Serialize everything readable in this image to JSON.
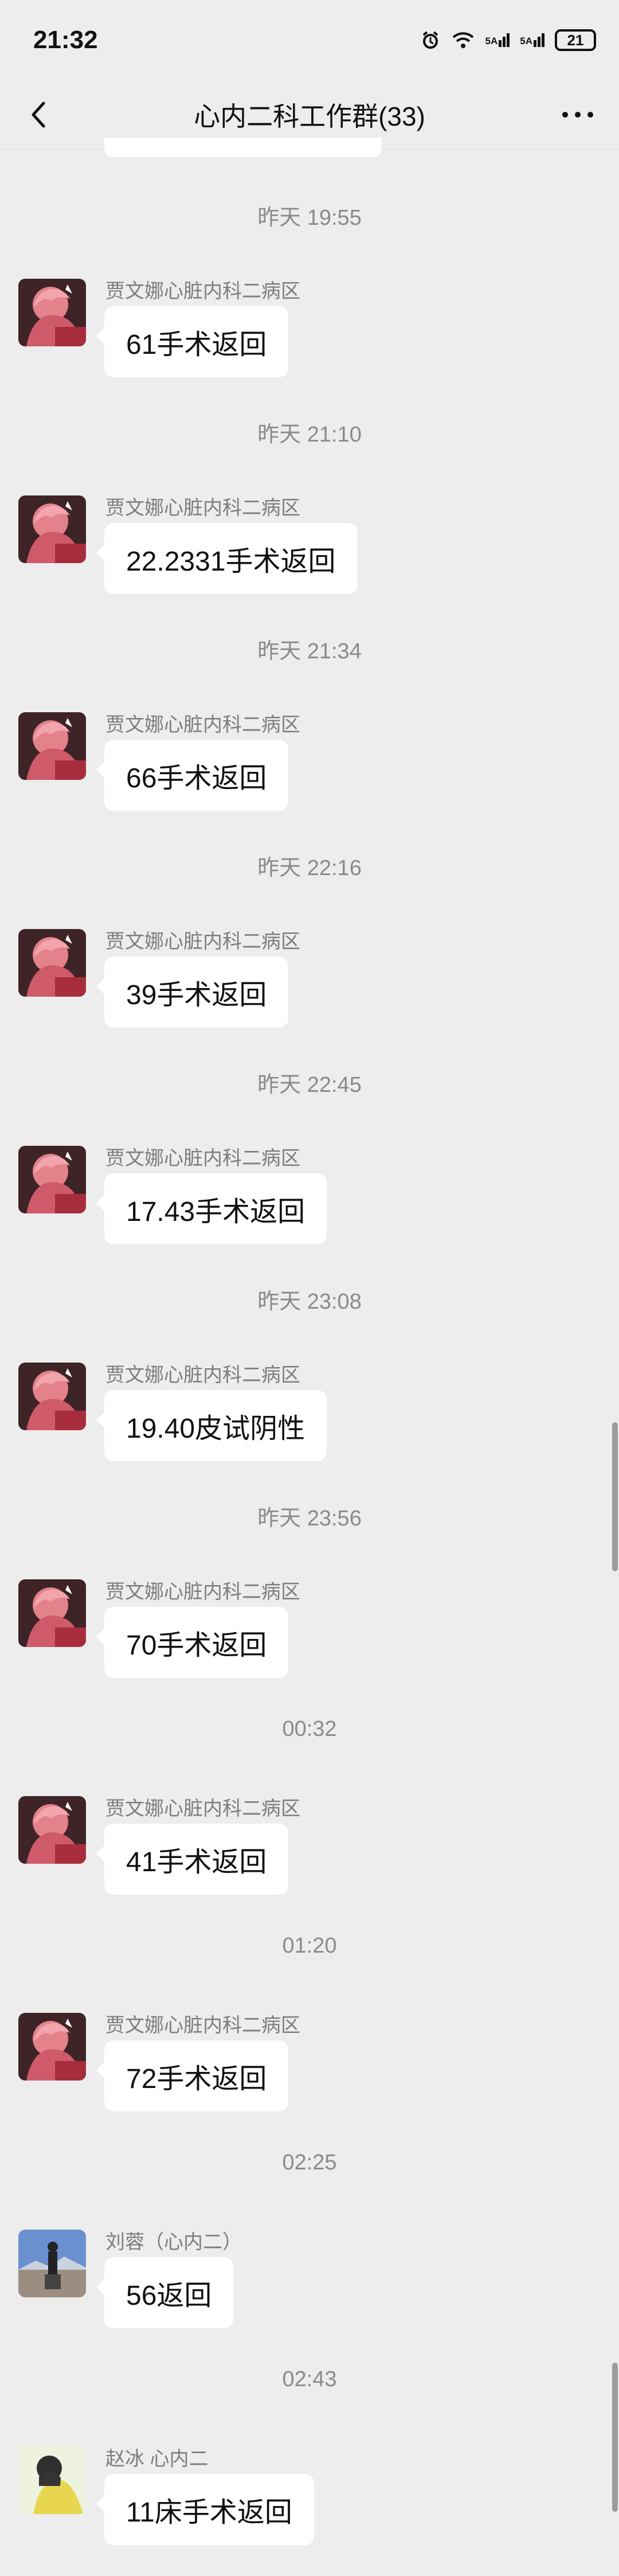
{
  "status": {
    "time": "21:32",
    "icons": [
      "alarm-icon",
      "wifi-icon",
      "signal-5a-icon",
      "signal-5a-icon"
    ],
    "signal_label": "5A",
    "battery": "21"
  },
  "header": {
    "title": "心内二科工作群(33)"
  },
  "messages": [
    {
      "time": "昨天 19:55",
      "sender": "贾文娜心脏内科二病区",
      "text": "61手术返回",
      "avatar": "avatar-pink-anime"
    },
    {
      "time": "昨天 21:10",
      "sender": "贾文娜心脏内科二病区",
      "text": "22.2331手术返回",
      "avatar": "avatar-pink-anime"
    },
    {
      "time": "昨天 21:34",
      "sender": "贾文娜心脏内科二病区",
      "text": "66手术返回",
      "avatar": "avatar-pink-anime"
    },
    {
      "time": "昨天 22:16",
      "sender": "贾文娜心脏内科二病区",
      "text": "39手术返回",
      "avatar": "avatar-pink-anime"
    },
    {
      "time": "昨天 22:45",
      "sender": "贾文娜心脏内科二病区",
      "text": "17.43手术返回",
      "avatar": "avatar-pink-anime"
    },
    {
      "time": "昨天 23:08",
      "sender": "贾文娜心脏内科二病区",
      "text": "19.40皮试阴性",
      "avatar": "avatar-pink-anime"
    },
    {
      "time": "昨天 23:56",
      "sender": "贾文娜心脏内科二病区",
      "text": "70手术返回",
      "avatar": "avatar-pink-anime"
    },
    {
      "time": "00:32",
      "sender": "贾文娜心脏内科二病区",
      "text": "41手术返回",
      "avatar": "avatar-pink-anime"
    },
    {
      "time": "01:20",
      "sender": "贾文娜心脏内科二病区",
      "text": "72手术返回",
      "avatar": "avatar-pink-anime"
    },
    {
      "time": "02:25",
      "sender": "刘蓉（心内二）",
      "text": "56返回",
      "avatar": "avatar-landscape"
    },
    {
      "time": "02:43",
      "sender": "赵冰    心内二",
      "text": "11床手术返回",
      "avatar": "avatar-yellow-figure"
    }
  ]
}
